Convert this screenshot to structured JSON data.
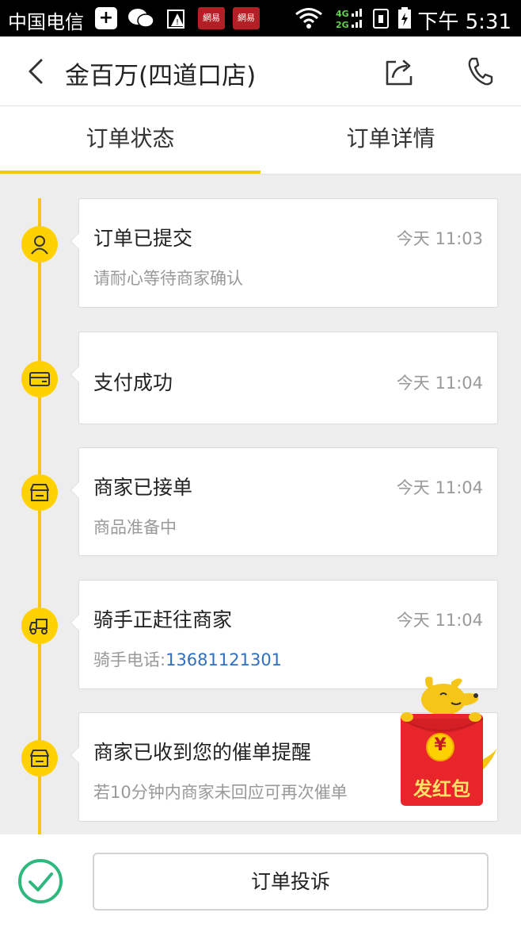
{
  "status_bar": {
    "carrier": "中国电信",
    "time": "下午 5:31",
    "app_badge": "網易",
    "network": "4G 2G"
  },
  "header": {
    "title": "金百万(四道口店)"
  },
  "tabs": [
    {
      "label": "订单状态",
      "active": true
    },
    {
      "label": "订单详情",
      "active": false
    }
  ],
  "timeline": [
    {
      "title": "订单已提交",
      "time": "今天 11:03",
      "subtitle": "请耐心等待商家确认",
      "icon": "user-icon"
    },
    {
      "title": "支付成功",
      "time": "今天 11:04",
      "subtitle": "",
      "icon": "card-icon"
    },
    {
      "title": "商家已接单",
      "time": "今天 11:04",
      "subtitle": "商品准备中",
      "icon": "store-icon"
    },
    {
      "title": "骑手正赶往商家",
      "time": "今天 11:04",
      "subtitle_label": "骑手电话:",
      "subtitle_phone": "13681121301",
      "icon": "delivery-truck-icon"
    },
    {
      "title": "商家已收到您的催单提醒",
      "time": "",
      "subtitle": "若10分钟内商家未回应可再次催单",
      "icon": "store-icon"
    }
  ],
  "red_packet": {
    "label": "发红包",
    "symbol": "¥"
  },
  "bottom": {
    "complaint_label": "订单投诉"
  },
  "colors": {
    "accent": "#ffd100",
    "link": "#2f6fc1",
    "red_packet": "#e8252b",
    "check": "#2fb87e"
  }
}
